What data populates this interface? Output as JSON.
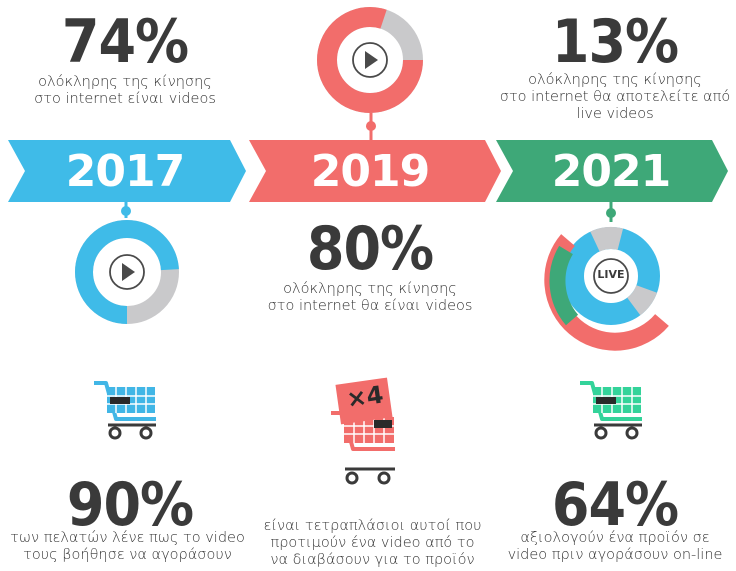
{
  "colors": {
    "blue": "#3fbbe8",
    "coral": "#f26d6b",
    "green": "#3ea878",
    "grey": "#c9c9cb",
    "cart_blue": "#41b6e6",
    "cart_coral": "#f26d6b",
    "cart_green": "#33d39a",
    "dark": "#3a3a3a"
  },
  "timeline": [
    {
      "year": "2017",
      "color": "blue"
    },
    {
      "year": "2019",
      "color": "coral"
    },
    {
      "year": "2021",
      "color": "green"
    }
  ],
  "stats_top": [
    {
      "value": "74%",
      "caption": [
        "ολόκληρης της κίνησης",
        "στο internet είναι videos"
      ]
    },
    {
      "value": "13%",
      "caption": [
        "ολόκληρης της κίνησης",
        "στο internet θα αποτελείτε από",
        "live videos"
      ]
    }
  ],
  "stat_mid": {
    "value": "80%",
    "caption": [
      "ολόκληρης της κίνησης",
      "στο internet θα είναι videos"
    ]
  },
  "live_badge": "LIVE",
  "multiplier": "×4",
  "stats_bottom": [
    {
      "value": "90%",
      "caption": [
        "των πελατών λένε πως το video",
        "τους βοήθησε να αγοράσουν"
      ]
    },
    {
      "value": "",
      "caption": [
        "είναι τετραπλάσιοι αυτοί που",
        "προτιμούν ένα video από το",
        "να διαβάσουν για το προϊόν"
      ]
    },
    {
      "value": "64%",
      "caption": [
        "αξιολογούν ένα προϊόν σε",
        "video πριν αγοράσουν on-line"
      ]
    }
  ]
}
